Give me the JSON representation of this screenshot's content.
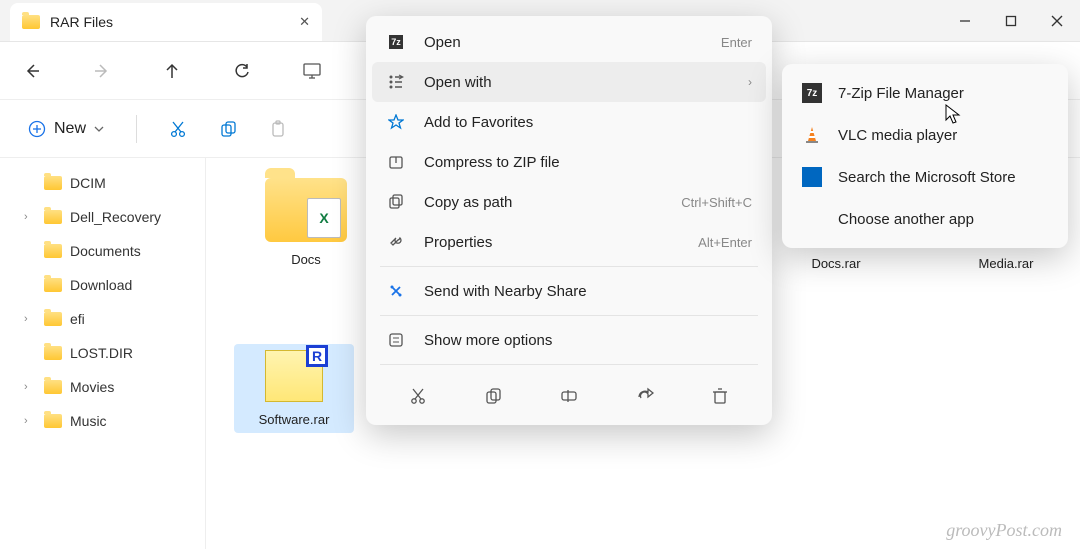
{
  "tab": {
    "title": "RAR Files"
  },
  "cmd": {
    "new": "New"
  },
  "tree": {
    "items": [
      {
        "label": "DCIM",
        "chevron": ""
      },
      {
        "label": "Dell_Recovery",
        "chevron": "›"
      },
      {
        "label": "Documents",
        "chevron": ""
      },
      {
        "label": "Download",
        "chevron": ""
      },
      {
        "label": "efi",
        "chevron": "›"
      },
      {
        "label": "LOST.DIR",
        "chevron": ""
      },
      {
        "label": "Movies",
        "chevron": "›"
      },
      {
        "label": "Music",
        "chevron": "›"
      }
    ]
  },
  "files": {
    "docs_folder": "Docs",
    "docs_rar": "Docs.rar",
    "media_rar": "Media.rar",
    "software_rar": "Software.rar"
  },
  "menu": {
    "open": "Open",
    "open_hint": "Enter",
    "openwith": "Open with",
    "fav": "Add to Favorites",
    "zip": "Compress to ZIP file",
    "copypath": "Copy as path",
    "copypath_hint": "Ctrl+Shift+C",
    "props": "Properties",
    "props_hint": "Alt+Enter",
    "nearby": "Send with Nearby Share",
    "more": "Show more options"
  },
  "submenu": {
    "sevenzip": "7-Zip File Manager",
    "vlc": "VLC media player",
    "store": "Search the Microsoft Store",
    "choose": "Choose another app"
  },
  "watermark": "groovyPost.com"
}
